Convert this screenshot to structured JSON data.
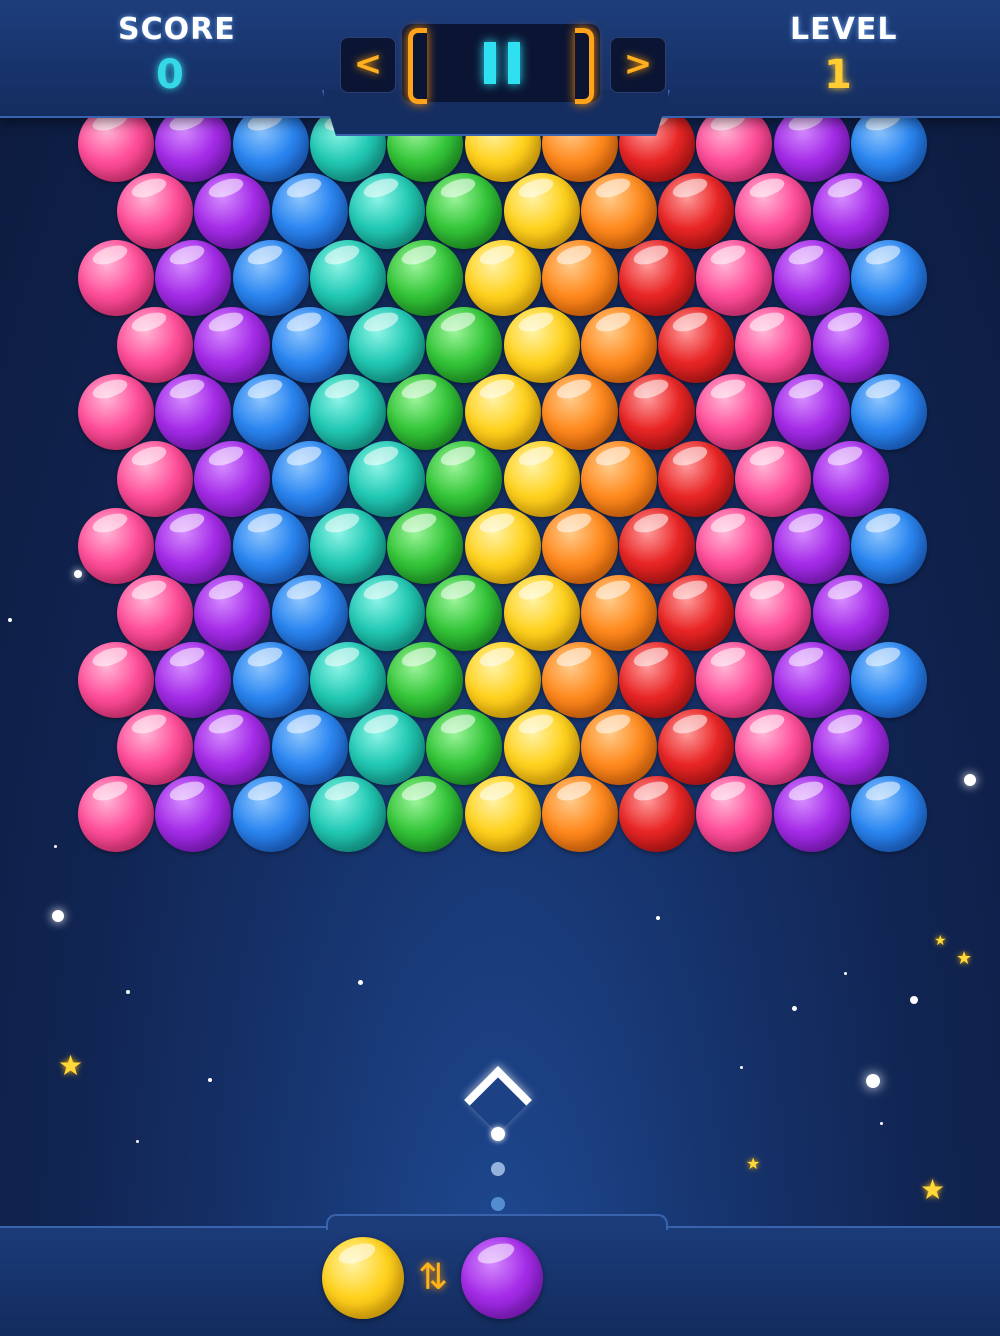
{
  "hud": {
    "score_label": "SCORE",
    "score_value": "0",
    "level_label": "LEVEL",
    "level_value": "1",
    "prev_label": "<",
    "next_label": ">"
  },
  "colors": {
    "pink": [
      "#ffb6d6",
      "#ff4f9a",
      "#e0266f"
    ],
    "purple": [
      "#d58cff",
      "#a52de8",
      "#7a12c0"
    ],
    "blue": [
      "#8ec6ff",
      "#2b86f0",
      "#1456c4"
    ],
    "teal": [
      "#8ef5e7",
      "#22c9b4",
      "#0e9685"
    ],
    "green": [
      "#9df59b",
      "#35c63a",
      "#168f1c"
    ],
    "yellow": [
      "#fff3a6",
      "#ffd21f",
      "#f0a800"
    ],
    "orange": [
      "#ffcc8c",
      "#ff8a1f",
      "#e35f00"
    ],
    "red": [
      "#ff9b9b",
      "#e92626",
      "#ae0d0d"
    ]
  },
  "board": {
    "even_row": [
      "pink",
      "purple",
      "blue",
      "teal",
      "green",
      "yellow",
      "orange",
      "red",
      "pink",
      "purple",
      "blue"
    ],
    "odd_row": [
      "pink",
      "purple",
      "blue",
      "teal",
      "green",
      "yellow",
      "orange",
      "red",
      "pink",
      "purple"
    ],
    "row_count": 11
  },
  "shooter": {
    "current": "yellow",
    "next": "purple",
    "swap_icon": "swap-arrows-icon",
    "aim_icon": "chevron-up-icon"
  }
}
